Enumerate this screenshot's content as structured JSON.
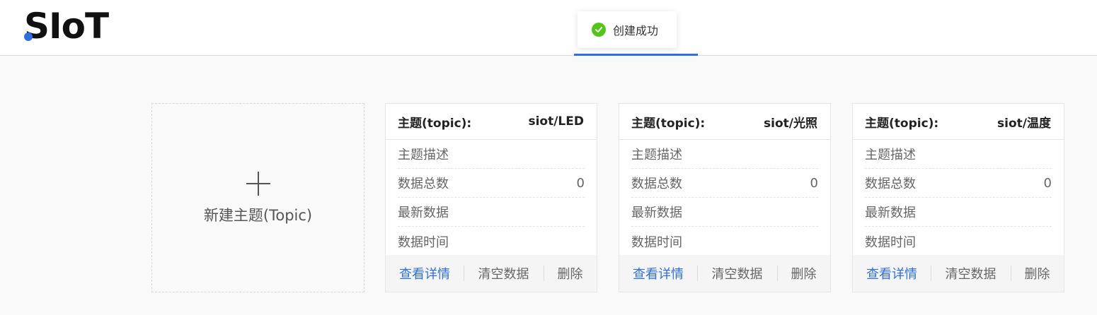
{
  "header": {
    "logo_text": "SIoT"
  },
  "toast": {
    "message": "创建成功",
    "icon": "check-circle-icon",
    "color": "#52c41a"
  },
  "new_topic": {
    "label": "新建主题(Topic)",
    "icon": "plus-icon"
  },
  "cards": [
    {
      "topic_label": "主题(topic):",
      "topic_name": "siot/LED",
      "rows": [
        {
          "label": "主题描述",
          "value": ""
        },
        {
          "label": "数据总数",
          "value": "0"
        },
        {
          "label": "最新数据",
          "value": ""
        },
        {
          "label": "数据时间",
          "value": ""
        }
      ],
      "actions": {
        "view": "查看详情",
        "clear": "清空数据",
        "delete": "删除"
      }
    },
    {
      "topic_label": "主题(topic):",
      "topic_name": "siot/光照",
      "rows": [
        {
          "label": "主题描述",
          "value": ""
        },
        {
          "label": "数据总数",
          "value": "0"
        },
        {
          "label": "最新数据",
          "value": ""
        },
        {
          "label": "数据时间",
          "value": ""
        }
      ],
      "actions": {
        "view": "查看详情",
        "clear": "清空数据",
        "delete": "删除"
      }
    },
    {
      "topic_label": "主题(topic):",
      "topic_name": "siot/温度",
      "rows": [
        {
          "label": "主题描述",
          "value": ""
        },
        {
          "label": "数据总数",
          "value": "0"
        },
        {
          "label": "最新数据",
          "value": ""
        },
        {
          "label": "数据时间",
          "value": ""
        }
      ],
      "actions": {
        "view": "查看详情",
        "clear": "清空数据",
        "delete": "删除"
      }
    }
  ],
  "colors": {
    "accent": "#2f6fe0",
    "success": "#52c41a"
  }
}
